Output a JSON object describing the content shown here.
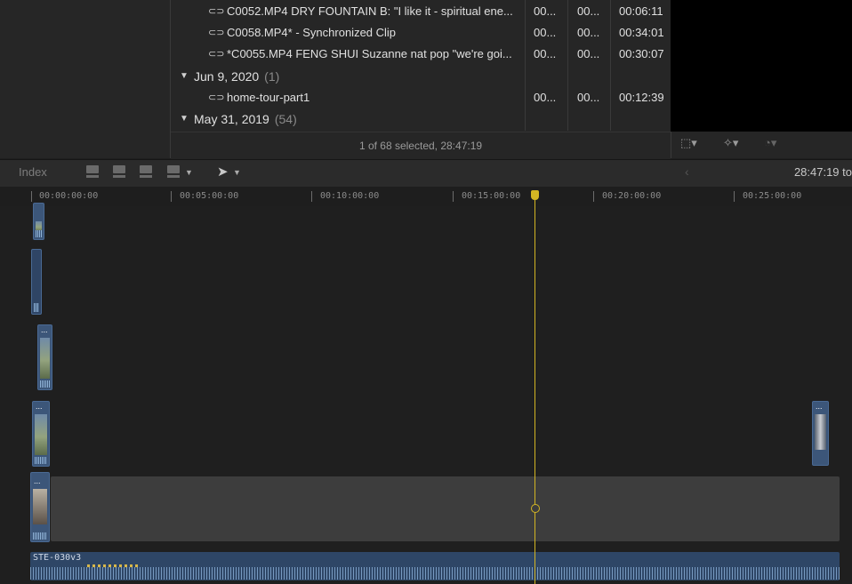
{
  "browser": {
    "rows": [
      {
        "name": "C0052.MP4 DRY FOUNTAIN B: \"I like it - spiritual ene...",
        "c1": "00...",
        "c2": "00...",
        "duration": "00:06:11"
      },
      {
        "name": "C0058.MP4* - Synchronized Clip",
        "c1": "00...",
        "c2": "00...",
        "duration": "00:34:01"
      },
      {
        "name": "*C0055.MP4 FENG SHUI Suzanne nat pop \"we're goi...",
        "c1": "00...",
        "c2": "00...",
        "duration": "00:30:07"
      }
    ],
    "group1": {
      "label": "Jun 9, 2020",
      "count": "(1)"
    },
    "group1_rows": [
      {
        "name": "home-tour-part1",
        "c1": "00...",
        "c2": "00...",
        "duration": "00:12:39"
      }
    ],
    "group2": {
      "label": "May 31, 2019",
      "count": "(54)"
    },
    "status": "1 of 68 selected, 28:47:19"
  },
  "viewer_toolbar": {
    "icons": [
      "crop-icon",
      "magic-wand-icon",
      "speed-icon"
    ]
  },
  "timeline_toolbar": {
    "index_label": "Index",
    "timecode": "28:47:19 to"
  },
  "ruler": {
    "labels": [
      "00:00:00:00",
      "00:05:00:00",
      "00:10:00:00",
      "00:15:00:00",
      "00:20:00:00",
      "00:25:00:00"
    ]
  },
  "clips": {
    "dots": "...",
    "audio_name": "STE-030v3"
  },
  "colors": {
    "playhead": "#d4b623",
    "clip_blue": "#3c5679",
    "gap_clip": "#3d3d3d"
  }
}
